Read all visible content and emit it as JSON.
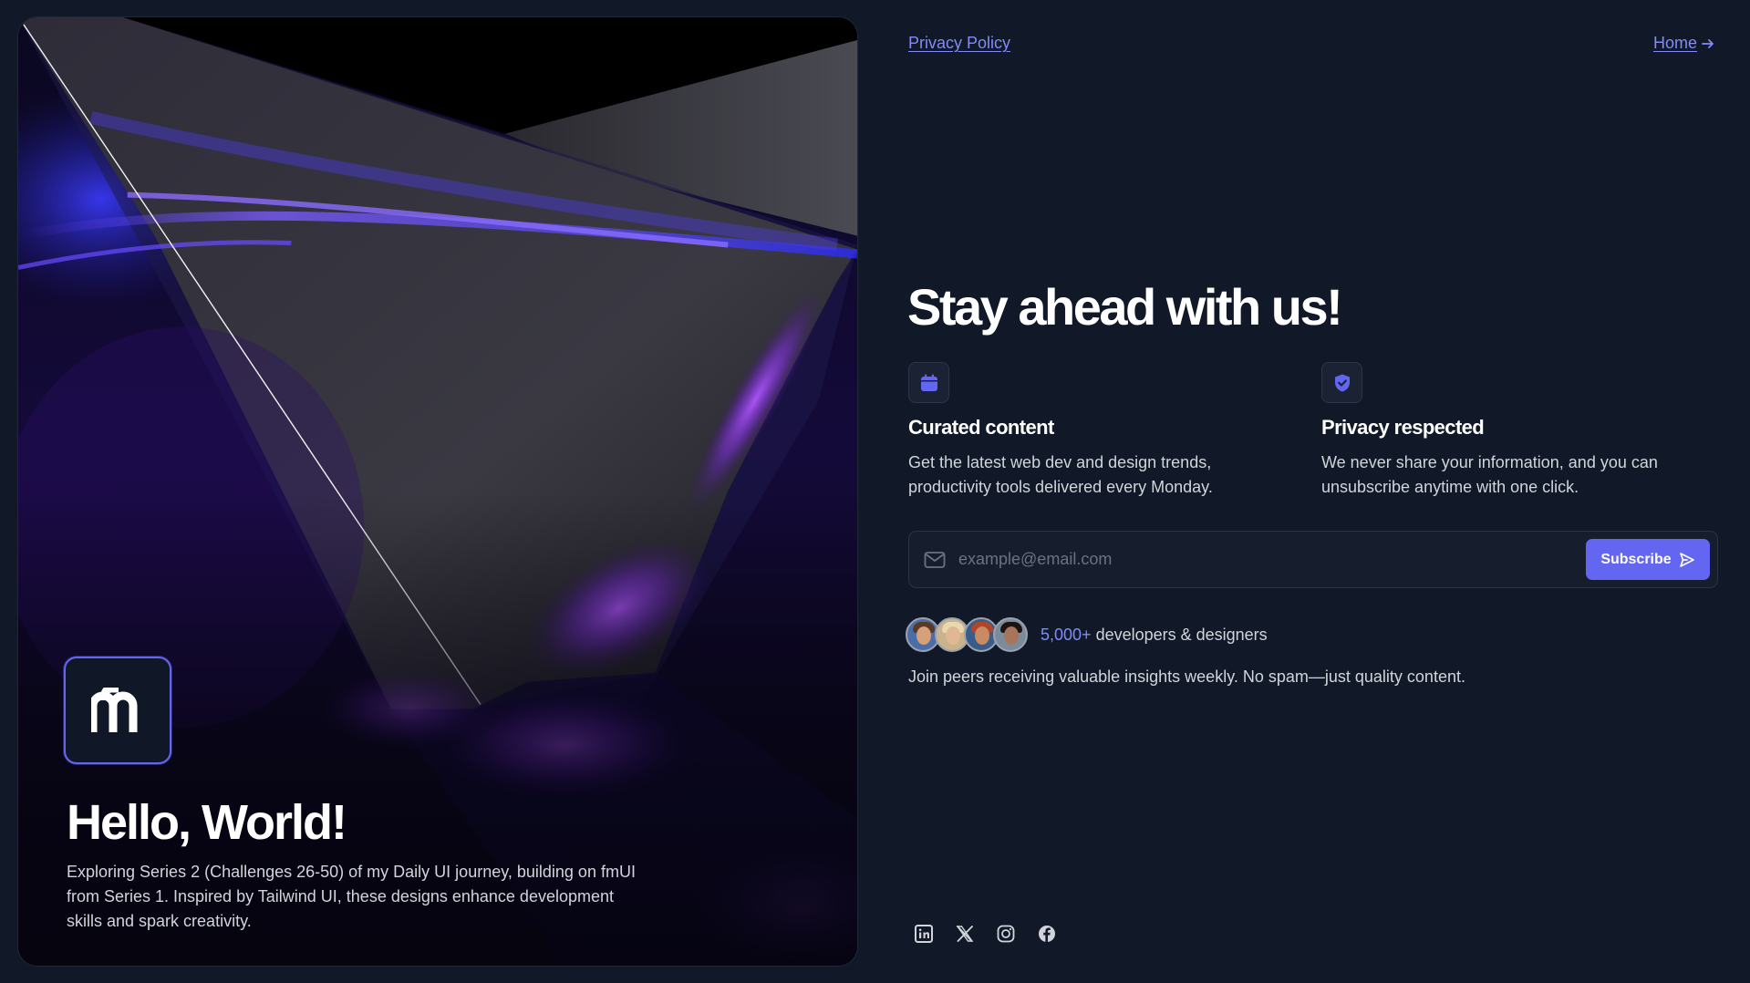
{
  "hero": {
    "title": "Hello, World!",
    "description": "Exploring Series 2 (Challenges 26-50) of my Daily UI journey, building on fmUI from Series 1. Inspired by Tailwind UI, these designs enhance development skills and spark creativity.",
    "logo_text": "fm"
  },
  "nav": {
    "privacy_label": "Privacy Policy",
    "home_label": "Home",
    "home_icon": "arrow-right-icon"
  },
  "main": {
    "title": "Stay ahead with us!"
  },
  "features": [
    {
      "icon": "calendar-icon",
      "title": "Curated content",
      "description": "Get the latest web dev and design trends, productivity tools delivered every Monday."
    },
    {
      "icon": "shield-check-icon",
      "title": "Privacy respected",
      "description": "We never share your information, and you can unsubscribe anytime with one click."
    }
  ],
  "form": {
    "placeholder": "example@email.com",
    "value": "",
    "button_label": "Subscribe",
    "button_icon": "send-icon"
  },
  "social_proof": {
    "count": "5,000+",
    "label": " developers & designers",
    "note": "Join peers receiving valuable insights weekly. No spam—just quality content."
  },
  "socials": [
    "linkedin-icon",
    "x-icon",
    "instagram-icon",
    "facebook-icon"
  ],
  "colors": {
    "background": "#111827",
    "accent": "#6366f1",
    "accent_text": "#818cf8",
    "text_primary": "#ffffff",
    "text_secondary": "#d1d5db"
  }
}
